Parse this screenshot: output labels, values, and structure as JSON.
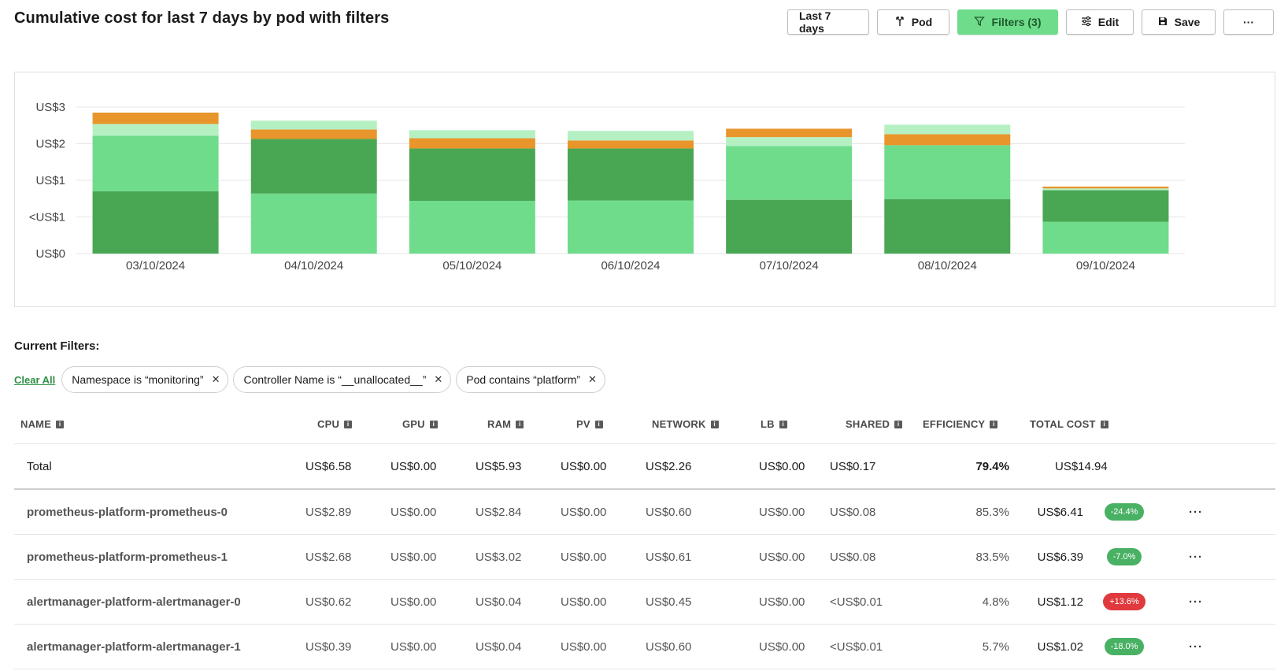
{
  "title": "Cumulative cost for last 7 days by pod with filters",
  "toolbar": {
    "range_label": "Last 7 days",
    "aggregate_label": "Pod",
    "filters_label": "Filters (3)",
    "edit_label": "Edit",
    "save_label": "Save",
    "more_label": "···"
  },
  "chart_data": {
    "type": "bar",
    "stacked": true,
    "categories": [
      "03/10/2024",
      "04/10/2024",
      "05/10/2024",
      "06/10/2024",
      "07/10/2024",
      "08/10/2024",
      "09/10/2024"
    ],
    "y_tick_labels": [
      "US$0",
      "<US$1",
      "US$1",
      "US$2",
      "US$3"
    ],
    "ylim": [
      0,
      4
    ],
    "grid": true,
    "series": [
      {
        "color": "#49a754",
        "values": [
          1.7,
          0.0,
          0.0,
          0.0,
          1.47,
          1.49,
          0.0
        ]
      },
      {
        "color": "#6fdc8c",
        "values": [
          1.52,
          1.64,
          1.44,
          1.45,
          1.47,
          1.47,
          0.87
        ]
      },
      {
        "color": "#49a754",
        "values": [
          0.0,
          1.49,
          1.43,
          1.42,
          0.0,
          0.0,
          0.86
        ]
      },
      {
        "color": "#b5f0c3",
        "values": [
          0.32,
          0.0,
          0.0,
          0.0,
          0.24,
          0.0,
          0.05
        ]
      },
      {
        "color": "#e8952c",
        "values": [
          0.31,
          0.26,
          0.28,
          0.22,
          0.23,
          0.3,
          0.05
        ]
      },
      {
        "color": "#b5f0c3",
        "values": [
          0.0,
          0.24,
          0.22,
          0.26,
          0.0,
          0.26,
          0.0
        ]
      }
    ]
  },
  "filters": {
    "label": "Current Filters:",
    "clear_all": "Clear All",
    "chips": [
      "Namespace is “monitoring”",
      "Controller Name is “__unallocated__”",
      "Pod contains “platform”"
    ]
  },
  "table": {
    "headers": [
      "NAME",
      "CPU",
      "GPU",
      "RAM",
      "PV",
      "NETWORK",
      "LB",
      "SHARED",
      "EFFICIENCY",
      "TOTAL COST"
    ],
    "total": {
      "name": "Total",
      "cpu": "US$6.58",
      "gpu": "US$0.00",
      "ram": "US$5.93",
      "pv": "US$0.00",
      "network": "US$2.26",
      "lb": "US$0.00",
      "shared": "US$0.17",
      "efficiency": "79.4%",
      "total_cost": "US$14.94"
    },
    "rows": [
      {
        "name": "prometheus-platform-prometheus-0",
        "cpu": "US$2.89",
        "gpu": "US$0.00",
        "ram": "US$2.84",
        "pv": "US$0.00",
        "network": "US$0.60",
        "lb": "US$0.00",
        "shared": "US$0.08",
        "efficiency": "85.3%",
        "total_cost": "US$6.41",
        "delta": "-24.4%",
        "delta_dir": "down"
      },
      {
        "name": "prometheus-platform-prometheus-1",
        "cpu": "US$2.68",
        "gpu": "US$0.00",
        "ram": "US$3.02",
        "pv": "US$0.00",
        "network": "US$0.61",
        "lb": "US$0.00",
        "shared": "US$0.08",
        "efficiency": "83.5%",
        "total_cost": "US$6.39",
        "delta": "-7.0%",
        "delta_dir": "down"
      },
      {
        "name": "alertmanager-platform-alertmanager-0",
        "cpu": "US$0.62",
        "gpu": "US$0.00",
        "ram": "US$0.04",
        "pv": "US$0.00",
        "network": "US$0.45",
        "lb": "US$0.00",
        "shared": "<US$0.01",
        "efficiency": "4.8%",
        "total_cost": "US$1.12",
        "delta": "+13.6%",
        "delta_dir": "up"
      },
      {
        "name": "alertmanager-platform-alertmanager-1",
        "cpu": "US$0.39",
        "gpu": "US$0.00",
        "ram": "US$0.04",
        "pv": "US$0.00",
        "network": "US$0.60",
        "lb": "US$0.00",
        "shared": "<US$0.01",
        "efficiency": "5.7%",
        "total_cost": "US$1.02",
        "delta": "-18.0%",
        "delta_dir": "down"
      }
    ],
    "row_more": "···"
  }
}
